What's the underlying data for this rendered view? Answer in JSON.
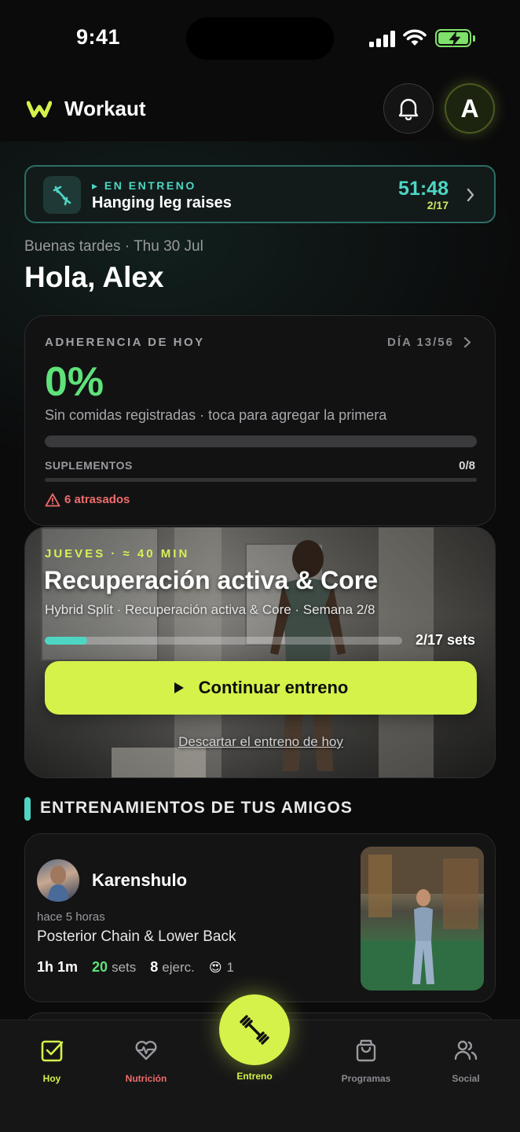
{
  "status_bar": {
    "time": "9:41"
  },
  "header": {
    "app_name": "Workaut",
    "avatar_initial": "A"
  },
  "live_workout": {
    "label": "▸ EN ENTRENO",
    "exercise": "Hanging leg raises",
    "timer": "51:48",
    "progress": "2/17",
    "accent_color": "#4ed6c3"
  },
  "greeting": {
    "subtitle": "Buenas tardes · Thu 30 Jul",
    "title": "Hola, Alex"
  },
  "adherence": {
    "label": "ADHERENCIA DE HOY",
    "day": "DÍA 13/56",
    "percent": "0%",
    "percent_value": 0,
    "description": "Sin comidas registradas · toca para agregar la primera",
    "supplements_label": "SUPLEMENTOS",
    "supplements_count": "0/8",
    "supplements_value": 0,
    "late_text": "6 atrasados",
    "accent_color": "#5ee27a",
    "warning_color": "#ef6c6c"
  },
  "workout": {
    "kicker": "JUEVES · ≈ 40 MIN",
    "title": "Recuperación activa & Core",
    "subtitle": "Hybrid Split · Recuperación activa & Core · Semana 2/8",
    "sets_label": "2/17 sets",
    "progress_fraction": 0.1176,
    "cta_label": "Continuar entreno",
    "discard_label": "Descartar el entreno de hoy",
    "cta_color": "#d4f24a"
  },
  "friends": {
    "section_title": "ENTRENAMIENTOS DE TUS AMIGOS",
    "items": [
      {
        "name": "Karenshulo",
        "time": "hace 5 horas",
        "workout": "Posterior Chain & Lower Back",
        "duration": "1h 1m",
        "sets_num": "20",
        "sets_label": "sets",
        "exercises_num": "8",
        "exercises_label": "ejerc.",
        "reaction": "😍",
        "reaction_count": "1"
      }
    ]
  },
  "tab_bar": {
    "tabs": [
      {
        "label": "Hoy",
        "icon": "checkbox-icon",
        "color": "#d4f24a"
      },
      {
        "label": "Nutrición",
        "icon": "heart-pulse-icon",
        "color": "#ef6c6c"
      },
      {
        "label": "Entreno",
        "icon": "dumbbell-icon",
        "color": "#d4f24a"
      },
      {
        "label": "Programas",
        "icon": "bag-icon",
        "color": "#8a8a8f"
      },
      {
        "label": "Social",
        "icon": "users-icon",
        "color": "#8a8a8f"
      }
    ]
  }
}
